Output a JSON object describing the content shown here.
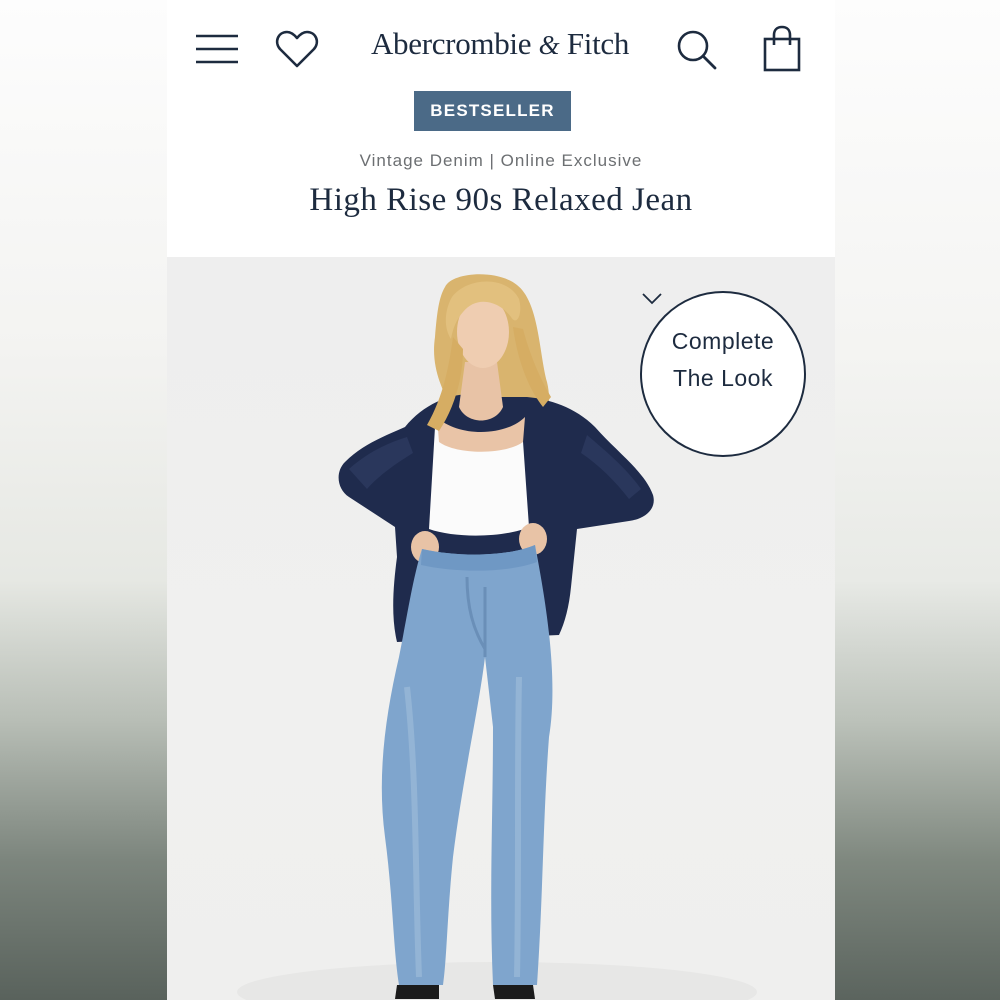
{
  "header": {
    "brand_main": "Abercrombie",
    "brand_amp": "&",
    "brand_end": "Fitch",
    "menu_icon": "hamburger-menu-icon",
    "wishlist_icon": "heart-icon",
    "search_icon": "search-icon",
    "bag_icon": "shopping-bag-icon"
  },
  "product": {
    "badge": "BESTSELLER",
    "subtitle": "Vintage Denim | Online Exclusive",
    "title": "High Rise 90s Relaxed Jean"
  },
  "complete_look": {
    "line1": "Complete",
    "line2": "The Look",
    "icon": "chevron-down-icon"
  },
  "colors": {
    "brand_navy": "#1d2b3f",
    "badge_blue": "#4b6a87",
    "subtitle_gray": "#6c6f72"
  }
}
